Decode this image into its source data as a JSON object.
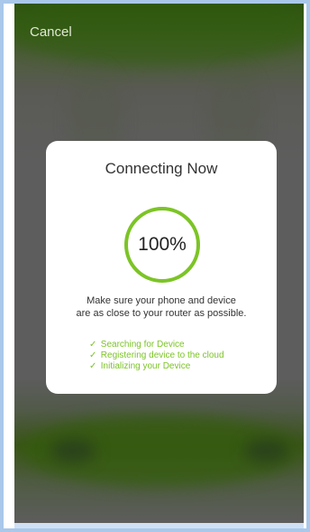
{
  "header": {
    "cancel_label": "Cancel"
  },
  "dialog": {
    "title": "Connecting Now",
    "progress_text": "100%",
    "progress_value": 1.0,
    "advice_line1": "Make sure your phone and device",
    "advice_line2": "are as close to your router as possible.",
    "steps": [
      {
        "label": "Searching for Device",
        "status": "done"
      },
      {
        "label": "Registering device to the cloud",
        "status": "done"
      },
      {
        "label": "Initializing your Device",
        "status": "done"
      }
    ],
    "check_icon": "check-icon"
  },
  "colors": {
    "accent": "#7cc426",
    "ring_track": "#e9f4dc",
    "overlay": "#5d5d5d"
  }
}
